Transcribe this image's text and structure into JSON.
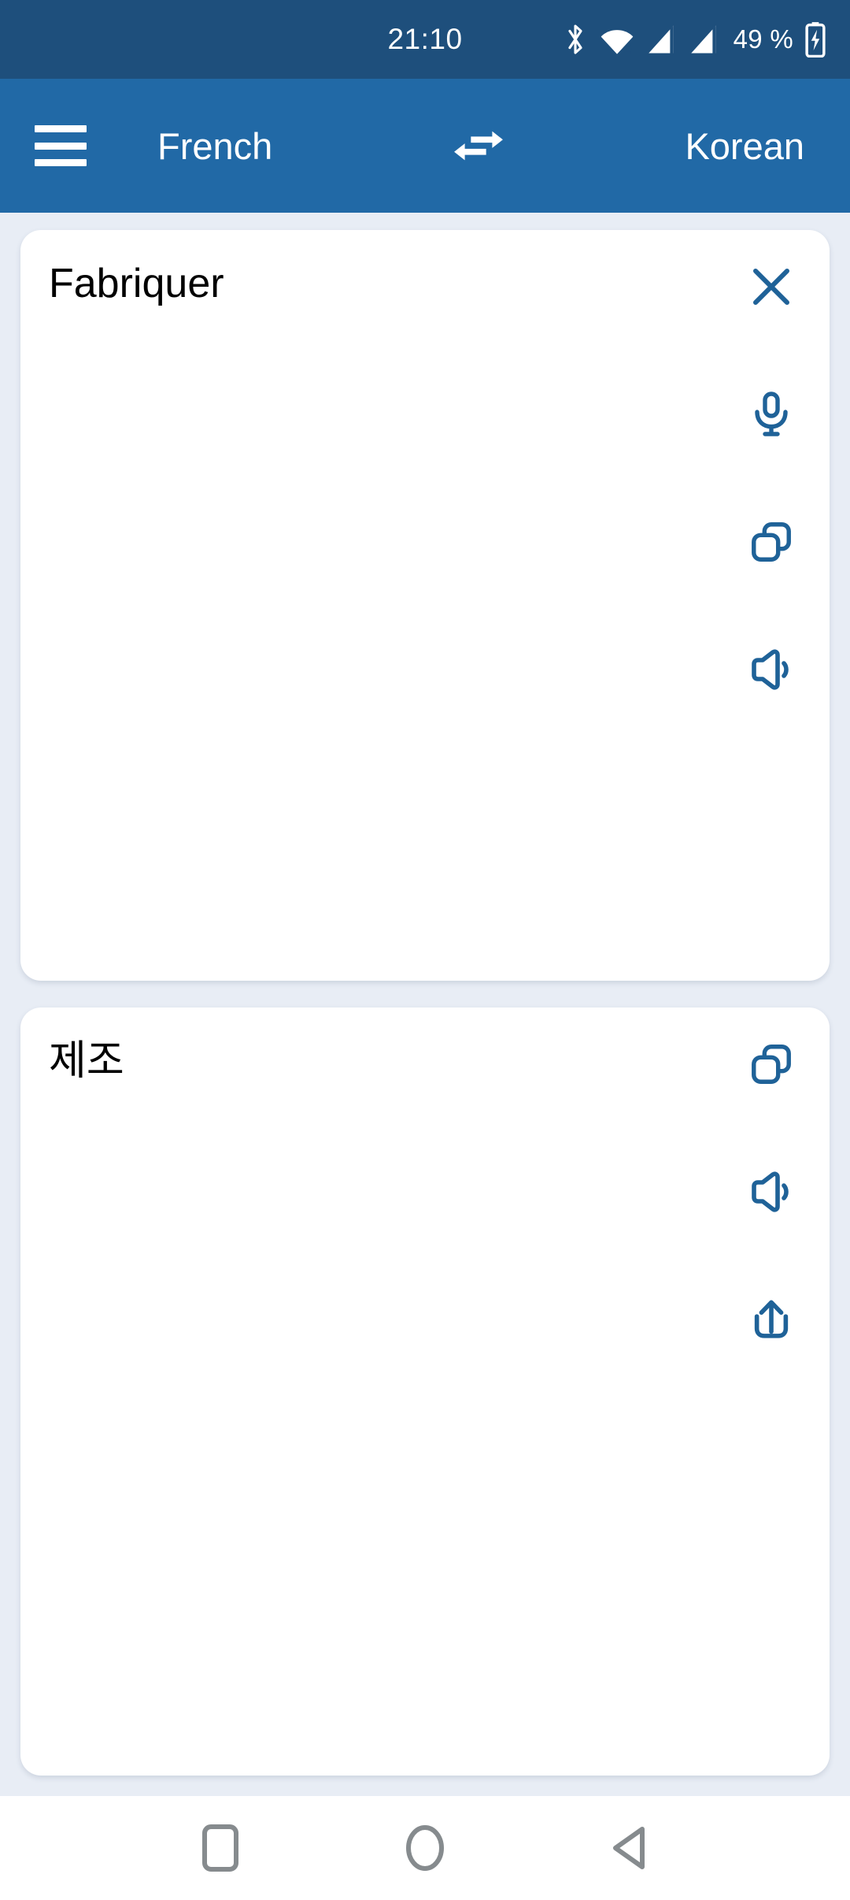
{
  "status_bar": {
    "time": "21:10",
    "battery_percent": "49 %",
    "icons": [
      "bluetooth-icon",
      "wifi-icon",
      "signal-cellular-1-icon",
      "signal-cellular-2-icon",
      "battery-charging-icon"
    ],
    "background_color": "#1e4f7c"
  },
  "app_bar": {
    "menu_icon": "hamburger-menu-icon",
    "source_language": "French",
    "swap_icon": "swap-horizontal-icon",
    "target_language": "Korean",
    "background_color": "#2169a6",
    "text_color": "#ffffff"
  },
  "source_card": {
    "text": "Fabriquer",
    "actions": [
      {
        "name": "close-icon",
        "label": "Clear"
      },
      {
        "name": "microphone-icon",
        "label": "Speak"
      },
      {
        "name": "copy-icon",
        "label": "Copy"
      },
      {
        "name": "speaker-icon",
        "label": "Listen"
      }
    ],
    "icon_color": "#1f6298",
    "background_color": "#ffffff"
  },
  "target_card": {
    "text": "제조",
    "actions": [
      {
        "name": "copy-icon",
        "label": "Copy"
      },
      {
        "name": "speaker-icon",
        "label": "Listen"
      },
      {
        "name": "share-icon",
        "label": "Share"
      }
    ],
    "icon_color": "#1f6298",
    "background_color": "#ffffff"
  },
  "nav_bar": {
    "buttons": [
      {
        "name": "recents-button",
        "label": "Recents"
      },
      {
        "name": "home-button",
        "label": "Home"
      },
      {
        "name": "back-button",
        "label": "Back"
      }
    ],
    "icon_color": "#868b8e",
    "background_color": "#ffffff"
  },
  "page": {
    "background_color": "#e8edf5"
  }
}
